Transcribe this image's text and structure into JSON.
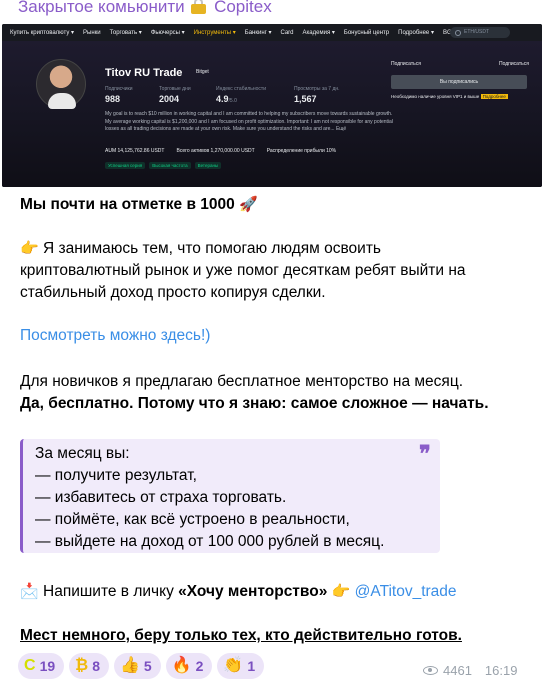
{
  "channel": {
    "title_prefix": "Закрытое комьюнити",
    "title_suffix": "Copitex"
  },
  "screenshot": {
    "nav_items": [
      "Купить криптовалюту ▾",
      "Рынки",
      "Торговать ▾",
      "Фьючерсы ▾",
      "Инструменты ▾",
      "Банкинг ▾",
      "Card",
      "Академия ▾",
      "Бонусный центр",
      "Подробнее ▾",
      "BGL"
    ],
    "active_nav": "Инструменты ▾",
    "search_placeholder": "ETH/USDT",
    "trader_name": "Titov RU Trade",
    "trader_badge": "Bitget",
    "stats": [
      {
        "label": "Подписчики",
        "value": "988",
        "unit": ""
      },
      {
        "label": "Торговые дни",
        "value": "2004",
        "unit": ""
      },
      {
        "label": "Индекс стабильности",
        "value": "4.9",
        "unit": "/5.0"
      },
      {
        "label": "Просмотры за 7 дн.",
        "value": "1,567",
        "unit": ""
      }
    ],
    "subscribe_link": "Подписаться",
    "subscribers_link": "Подписаться",
    "subscribed_button": "Вы подписались",
    "vip_note": "Необходимо наличие уровня VIP1 и выше",
    "vip_button": "Подробнее",
    "description": "My goal is to reach $10 million in working capital and I am committed to helping my subscribers move towards sustainable growth. My average working capital is $1,200,000 and I am focused on profit optimization. Important: I am not responsible for any potential losses as all trading decisions are made at your own risk. Make sure you understand the risks and are... Ещё",
    "metrics": [
      "AUM 14,125,762.86 USDT",
      "Всего активов 1,270,000.00 USDT",
      "Распределение прибыли 10%"
    ],
    "tags": [
      "Успешная серия",
      "Высокая частота",
      "Ветераны"
    ]
  },
  "message": {
    "headline": "Мы почти на отметке в 1000",
    "headline_emoji": "🚀",
    "intro_emoji": "👉",
    "intro_lines": [
      "Я занимаюсь тем, что помогаю людям освоить",
      "криптовалютный рынок и уже помог десяткам ребят выйти на",
      "стабильный доход просто копируя сделки."
    ],
    "link_text": "Посмотреть можно здесь!)",
    "mentorship_line1": "Для новичков я предлагаю бесплатное менторство на месяц.",
    "mentorship_line2": "Да, бесплатно. Потому что я знаю: самое сложное — начать.",
    "quote_lines": [
      "За месяц вы:",
      "— получите результат,",
      "— избавитесь от страха торговать.",
      "— поймёте, как всё устроено в реальности,",
      "— выйдете на доход от 100 000 рублей в месяц."
    ],
    "contact_emoji": "📩",
    "contact_prefix": "Напишите в личку",
    "contact_bold": "«Хочу менторство»",
    "contact_emoji2": "👉",
    "contact_handle": "@ATitov_trade",
    "closing": "Мест немного, беру только тех, кто действительно готов."
  },
  "reactions": [
    {
      "icon": "C",
      "icon_color": "#d4e000",
      "count": "19"
    },
    {
      "icon": "₿",
      "icon_color": "#f0b90b",
      "count": "8"
    },
    {
      "icon": "👍",
      "icon_color": "#e8a33a",
      "count": "5"
    },
    {
      "icon": "🔥",
      "icon_color": "#ff6b1a",
      "count": "2"
    },
    {
      "icon": "👏",
      "icon_color": "#e8a33a",
      "count": "1"
    }
  ],
  "views": "4461",
  "time": "16:19"
}
